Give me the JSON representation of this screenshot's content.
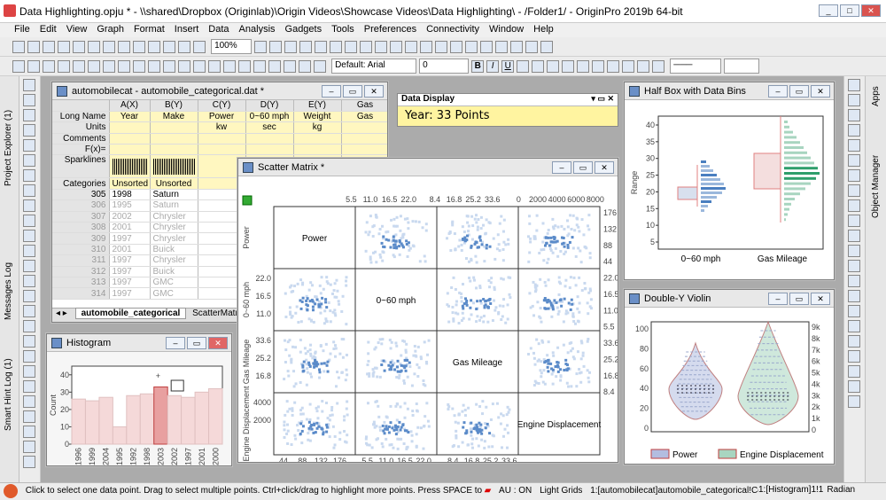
{
  "title": "Data Highlighting.opju * - \\\\shared\\Dropbox (Originlab)\\Origin Videos\\Showcase Videos\\Data Highlighting\\ - /Folder1/ - OriginPro 2019b 64-bit",
  "menu": [
    "File",
    "Edit",
    "View",
    "Graph",
    "Format",
    "Insert",
    "Data",
    "Analysis",
    "Gadgets",
    "Tools",
    "Preferences",
    "Connectivity",
    "Window",
    "Help"
  ],
  "toolbar": {
    "zoom": "100%",
    "font": "Default: Arial",
    "size": "0"
  },
  "left_tabs": [
    "Project Explorer (1)",
    "Messages Log",
    "Smart Hint Log (1)"
  ],
  "right_tabs": [
    "Apps",
    "Object Manager"
  ],
  "sheet": {
    "title": "automobilecat - automobile_categorical.dat *",
    "columns": [
      "A(X)",
      "B(Y)",
      "C(Y)",
      "D(Y)",
      "E(Y)",
      "Gas"
    ],
    "meta": [
      {
        "label": "Long Name",
        "values": [
          "Year",
          "Make",
          "Power",
          "0~60 mph",
          "Weight",
          "Gas"
        ]
      },
      {
        "label": "Units",
        "values": [
          "",
          "",
          "kw",
          "sec",
          "kg",
          ""
        ]
      },
      {
        "label": "Comments",
        "values": [
          "",
          "",
          "",
          "",
          "",
          ""
        ]
      },
      {
        "label": "F(x)=",
        "values": [
          "",
          "",
          "",
          "",
          "",
          ""
        ]
      },
      {
        "label": "Sparklines",
        "values": [
          "",
          "",
          "",
          "",
          "",
          ""
        ]
      },
      {
        "label": "Categories",
        "values": [
          "Unsorted",
          "Unsorted",
          "",
          "",
          "",
          ""
        ]
      }
    ],
    "rows": [
      [
        "305",
        "1998",
        "Saturn"
      ],
      [
        "306",
        "1995",
        "Saturn"
      ],
      [
        "307",
        "2002",
        "Chrysler"
      ],
      [
        "308",
        "2001",
        "Chrysler"
      ],
      [
        "309",
        "1997",
        "Chrysler"
      ],
      [
        "310",
        "2001",
        "Buick"
      ],
      [
        "311",
        "1997",
        "Chrysler"
      ],
      [
        "312",
        "1997",
        "Buick"
      ],
      [
        "313",
        "1997",
        "GMC"
      ],
      [
        "314",
        "1997",
        "GMC"
      ]
    ],
    "tabs": [
      "automobile_categorical",
      "ScatterMatri"
    ]
  },
  "data_display": {
    "title": "Data Display",
    "text": "Year: 33 Points"
  },
  "scatter": {
    "title": "Scatter Matrix *",
    "labels": [
      "Power",
      "0~60 mph",
      "Gas Mileage",
      "Engine Displacement"
    ],
    "top_ticks": [
      "5.5",
      "11.0",
      "16.5",
      "22.0",
      "8.4",
      "16.8",
      "25.2",
      "33.6",
      "0",
      "2000",
      "4000",
      "6000",
      "8000"
    ],
    "bottom_ticks": [
      "44",
      "88",
      "132",
      "176",
      "5.5",
      "11.0",
      "16.5",
      "22.0",
      "8.4",
      "16.8",
      "25.2",
      "33.6"
    ],
    "right_ticks": [
      "176",
      "132",
      "88",
      "44",
      "22.0",
      "16.5",
      "11.0",
      "5.5",
      "33.6",
      "25.2",
      "16.8",
      "8.4"
    ],
    "left_ticks": [
      "22.0",
      "16.5",
      "11.0",
      "33.6",
      "25.2",
      "16.8",
      "4000",
      "2000"
    ]
  },
  "halfbox": {
    "title": "Half Box with Data Bins",
    "ylabel": "Range",
    "yticks": [
      "40",
      "35",
      "30",
      "25",
      "20",
      "15",
      "10",
      "5"
    ],
    "categories": [
      "0~60 mph",
      "Gas Mileage"
    ]
  },
  "violin": {
    "title": "Double-Y Violin",
    "yticks_left": [
      "100",
      "80",
      "60",
      "40",
      "20",
      "0"
    ],
    "yticks_right": [
      "9k",
      "8k",
      "7k",
      "6k",
      "5k",
      "4k",
      "3k",
      "2k",
      "1k",
      "0"
    ],
    "legend": [
      "Power",
      "Engine Displacement"
    ]
  },
  "histogram": {
    "title": "Histogram",
    "ylabel": "Count",
    "yticks": [
      "40",
      "30",
      "20",
      "10",
      "0"
    ],
    "xticks": [
      "1996",
      "1999",
      "2004",
      "1995",
      "1992",
      "1998",
      "2003",
      "2002",
      "1997",
      "2001",
      "2000"
    ],
    "values": [
      26,
      25,
      27,
      10,
      28,
      29,
      33,
      28,
      27,
      30,
      32
    ],
    "ylim": [
      0,
      45
    ],
    "highlight_index": 6
  },
  "status": "Click to select one data point. Drag to select multiple points. Ctrl+click/drag to highlight more points. Press SPACE to togg",
  "status_right": [
    "AU : ON",
    "Light Grids",
    "1:[automobilecat]automobile_categorical!Col(\"Year\")[1:340]",
    "1:[Histogram]1!1",
    "Radian"
  ],
  "colors": {
    "bar": "#f5d9d9",
    "bar_highlight": "#e8a0a0",
    "scatter": "#5b8bc9",
    "violin_power": "#b3bde0",
    "violin_eng": "#a8d5c0"
  }
}
